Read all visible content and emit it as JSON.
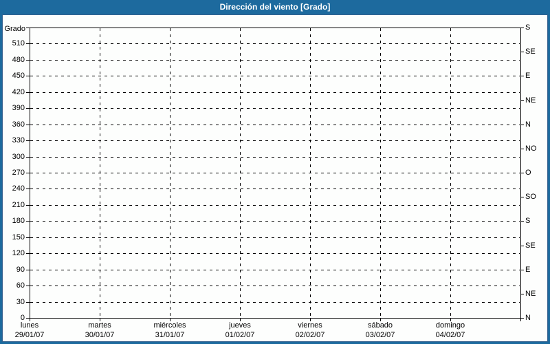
{
  "window": {
    "title": "Dirección del viento [Grado]"
  },
  "colors": {
    "frame_blue": "#1d6a9e",
    "title_text": "#ffffff",
    "plot_background": "#fdfefd",
    "axis_and_grid": "#000000"
  },
  "chart_data": {
    "type": "line",
    "title": "Dirección del viento [Grado]",
    "ylabel_left_unit": "Grado",
    "y_left": {
      "min": 0,
      "max": 540,
      "tick_step": 30,
      "tick_labels": [
        "0",
        "30",
        "60",
        "90",
        "120",
        "150",
        "180",
        "210",
        "240",
        "270",
        "300",
        "330",
        "360",
        "390",
        "420",
        "450",
        "480",
        "510"
      ]
    },
    "y_right_ticks": [
      {
        "value": 0,
        "label": "N"
      },
      {
        "value": 45,
        "label": "NE"
      },
      {
        "value": 90,
        "label": "E"
      },
      {
        "value": 135,
        "label": "SE"
      },
      {
        "value": 180,
        "label": "S"
      },
      {
        "value": 225,
        "label": "SO"
      },
      {
        "value": 270,
        "label": "O"
      },
      {
        "value": 315,
        "label": "NO"
      },
      {
        "value": 360,
        "label": "N"
      },
      {
        "value": 405,
        "label": "NE"
      },
      {
        "value": 450,
        "label": "E"
      },
      {
        "value": 495,
        "label": "SE"
      },
      {
        "value": 540,
        "label": "S"
      }
    ],
    "x_ticks": [
      {
        "name": "lunes",
        "date": "29/01/07"
      },
      {
        "name": "martes",
        "date": "30/01/07"
      },
      {
        "name": "miércoles",
        "date": "31/01/07"
      },
      {
        "name": "jueves",
        "date": "01/02/07"
      },
      {
        "name": "viernes",
        "date": "02/02/07"
      },
      {
        "name": "sábado",
        "date": "03/02/07"
      },
      {
        "name": "domingo",
        "date": "04/02/07"
      }
    ],
    "grid": true,
    "legend": false,
    "series": []
  }
}
